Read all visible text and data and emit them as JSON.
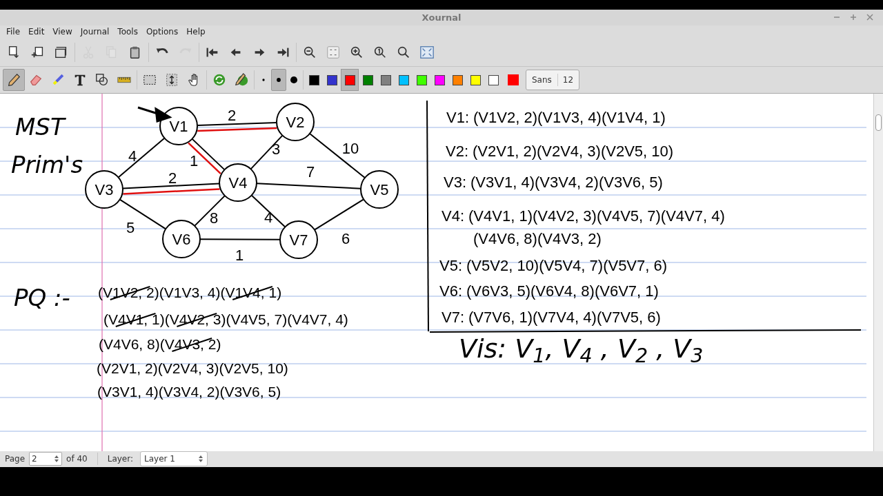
{
  "window": {
    "title": "Xournal"
  },
  "menu": [
    "File",
    "Edit",
    "View",
    "Journal",
    "Tools",
    "Options",
    "Help"
  ],
  "toolbar": [
    {
      "kind": "new",
      "disabled": false
    },
    {
      "kind": "addpage",
      "disabled": false
    },
    {
      "kind": "delpage",
      "disabled": false
    },
    {
      "kind": "sep"
    },
    {
      "kind": "cut",
      "disabled": true
    },
    {
      "kind": "copy",
      "disabled": true
    },
    {
      "kind": "paste",
      "disabled": false
    },
    {
      "kind": "sep"
    },
    {
      "kind": "undo",
      "disabled": false
    },
    {
      "kind": "redo",
      "disabled": true
    },
    {
      "kind": "sep"
    },
    {
      "kind": "first",
      "disabled": false
    },
    {
      "kind": "prev",
      "disabled": false
    },
    {
      "kind": "next",
      "disabled": false
    },
    {
      "kind": "last",
      "disabled": false
    },
    {
      "kind": "sep"
    },
    {
      "kind": "zoomout",
      "disabled": false
    },
    {
      "kind": "zoomfit",
      "disabled": false
    },
    {
      "kind": "zoomin",
      "disabled": false
    },
    {
      "kind": "zoom1",
      "disabled": false
    },
    {
      "kind": "zoomset",
      "disabled": false
    },
    {
      "kind": "fullscreen",
      "disabled": false
    }
  ],
  "tools": [
    {
      "kind": "pen",
      "selected": true
    },
    {
      "kind": "eraser",
      "selected": false
    },
    {
      "kind": "highlighter",
      "selected": false
    },
    {
      "kind": "text",
      "selected": false
    },
    {
      "kind": "shapes",
      "selected": false
    },
    {
      "kind": "ruler",
      "selected": false
    },
    {
      "kind": "sep"
    },
    {
      "kind": "selectrect",
      "selected": false
    },
    {
      "kind": "vspace",
      "selected": false
    },
    {
      "kind": "hand",
      "selected": false
    },
    {
      "kind": "sep"
    },
    {
      "kind": "default",
      "selected": false
    },
    {
      "kind": "defaultpen",
      "selected": false
    },
    {
      "kind": "sep"
    },
    {
      "kind": "thin",
      "selected": false
    },
    {
      "kind": "medium",
      "selected": true
    },
    {
      "kind": "thick",
      "selected": false
    }
  ],
  "colors": [
    {
      "color": "#000000",
      "selected": false
    },
    {
      "color": "#3333cc",
      "selected": false
    },
    {
      "color": "#ff0000",
      "selected": true
    },
    {
      "color": "#008000",
      "selected": false
    },
    {
      "color": "#808080",
      "selected": false
    },
    {
      "color": "#00c0ff",
      "selected": false
    },
    {
      "color": "#40ff00",
      "selected": false
    },
    {
      "color": "#ff00ff",
      "selected": false
    },
    {
      "color": "#ff8000",
      "selected": false
    },
    {
      "color": "#ffff00",
      "selected": false
    },
    {
      "color": "#ffffff",
      "selected": false
    }
  ],
  "current_color": {
    "color": "#ff0000"
  },
  "font_button": {
    "name": "Sans",
    "size": "12"
  },
  "notes": {
    "title_lines": [
      "MST",
      "Prim's"
    ],
    "pq_label": "PQ :-",
    "pq_lines": [
      [
        {
          "text": "(V1V2, 2)",
          "struck": true
        },
        {
          "text": "(V1V3, 4)",
          "struck": false
        },
        {
          "text": "(V1V4, 1)",
          "struck": true
        }
      ],
      [
        {
          "text": "(V4V1, 1)",
          "struck": true
        },
        {
          "text": "(V4V2, 3)",
          "struck": true
        },
        {
          "text": "(V4V5, 7)",
          "struck": false
        },
        {
          "text": "(V4V7, 4)",
          "struck": false
        }
      ],
      [
        {
          "text": "(V4V6, 8)",
          "struck": false
        },
        {
          "text": "(V4V3, 2)",
          "struck": true
        }
      ],
      [
        {
          "text": "(V2V1, 2)",
          "struck": false
        },
        {
          "text": "(V2V4, 3)",
          "struck": false
        },
        {
          "text": "(V2V5, 10)",
          "struck": false
        }
      ],
      [
        {
          "text": "(V3V1, 4)",
          "struck": false
        },
        {
          "text": "(V3V4, 2)",
          "struck": false
        },
        {
          "text": "(V3V6, 5)",
          "struck": false
        }
      ]
    ],
    "visited": "Vis: V$_{1}$, V$_{4}$ , V$_{2}$ , V$_{3}$"
  },
  "graph": {
    "nodes": [
      "V1",
      "V2",
      "V3",
      "V4",
      "V5",
      "V6",
      "V7"
    ],
    "edges": [
      {
        "weight": "2",
        "in_tree": true
      },
      {
        "weight": "4",
        "in_tree": false
      },
      {
        "weight": "1",
        "in_tree": true
      },
      {
        "weight": "3",
        "in_tree": false
      },
      {
        "weight": "10",
        "in_tree": false
      },
      {
        "weight": "2",
        "in_tree": true
      },
      {
        "weight": "7",
        "in_tree": false
      },
      {
        "weight": "5",
        "in_tree": false
      },
      {
        "weight": "8",
        "in_tree": false
      },
      {
        "weight": "4",
        "in_tree": false
      },
      {
        "weight": "1",
        "in_tree": false
      },
      {
        "weight": "6",
        "in_tree": false
      }
    ]
  },
  "adjacency": [
    {
      "label": "V1:",
      "lines": [
        "(V1V2, 2)(V1V3, 4)(V1V4, 1)"
      ]
    },
    {
      "label": "V2:",
      "lines": [
        "(V2V1, 2)(V2V4, 3)(V2V5, 10)"
      ]
    },
    {
      "label": "V3:",
      "lines": [
        "(V3V1, 4)(V3V4, 2)(V3V6, 5)"
      ]
    },
    {
      "label": "V4:",
      "lines": [
        "(V4V1, 1)(V4V2, 3)(V4V5, 7)(V4V7, 4)",
        "(V4V6, 8)(V4V3, 2)"
      ]
    },
    {
      "label": "V5:",
      "lines": [
        "(V5V2, 10)(V5V4, 7)(V5V7, 6)"
      ]
    },
    {
      "label": "V6:",
      "lines": [
        "(V6V3, 5)(V6V4, 8)(V6V7, 1)"
      ]
    },
    {
      "label": "V7:",
      "lines": [
        "(V7V6, 1)(V7V4, 4)(V7V5, 6)"
      ]
    }
  ],
  "status": {
    "page_label": "Page",
    "page": "2",
    "page_total": "of 40",
    "layer_label": "Layer:",
    "layer": "Layer 1"
  }
}
